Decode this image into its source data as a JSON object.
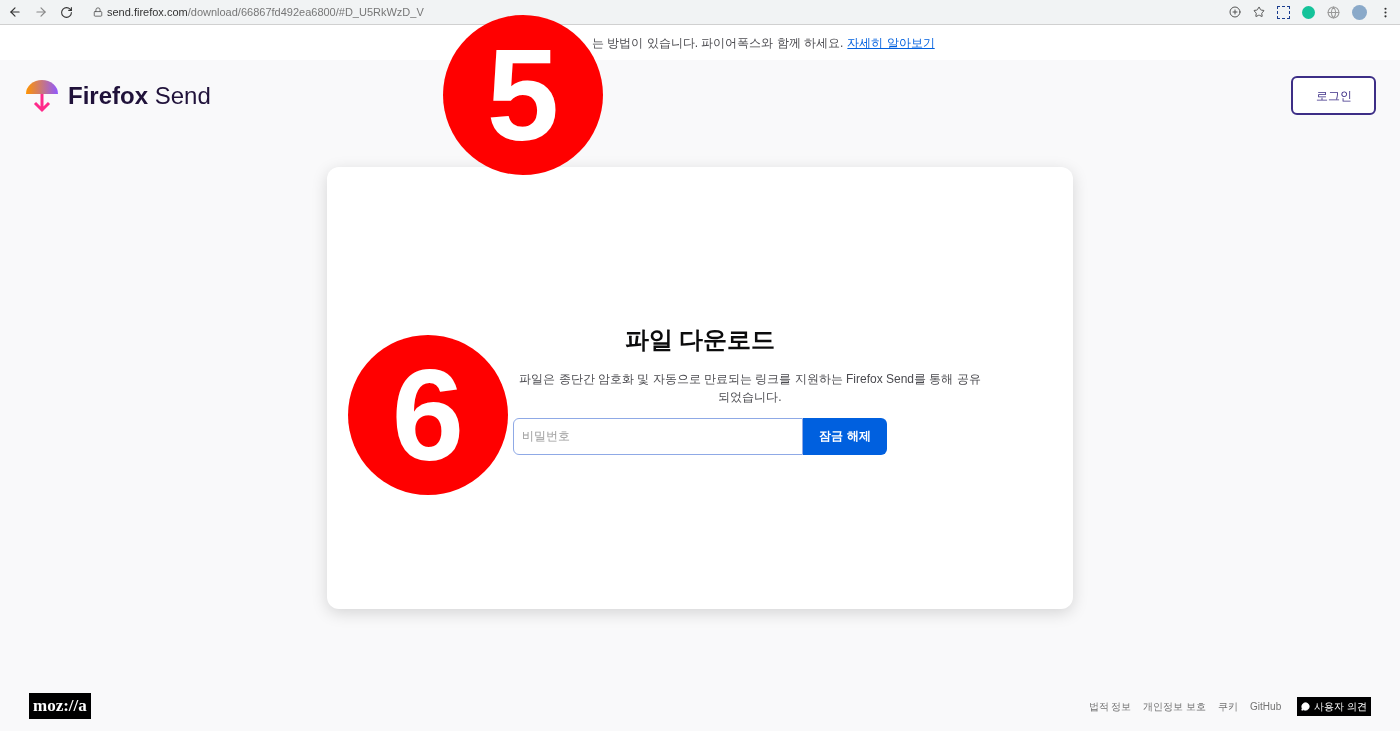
{
  "browser": {
    "url_host": "send.firefox.com",
    "url_path": "/download/66867fd492ea6800/#D_U5RkWzD_V"
  },
  "banner": {
    "text": "는 방법이 있습니다. 파이어폭스와 함께 하세요.",
    "link": "자세히 알아보기"
  },
  "header": {
    "logo_bold": "Firefox",
    "logo_light": "Send",
    "login_button": "로그인"
  },
  "card": {
    "title": "파일 다운로드",
    "description": "파일은 종단간 암호화 및 자동으로 만료되는 링크를 지원하는 Firefox Send를 통해 공유되었습니다.",
    "password": {
      "placeholder": "비밀번호"
    },
    "unlock_button": "잠금 해제"
  },
  "footer": {
    "logo": "moz://a",
    "links": [
      "법적 정보",
      "개인정보 보호",
      "쿠키",
      "GitHub"
    ],
    "feedback": "사용자 의견"
  },
  "annotations": [
    {
      "label": "5"
    },
    {
      "label": "6"
    }
  ]
}
